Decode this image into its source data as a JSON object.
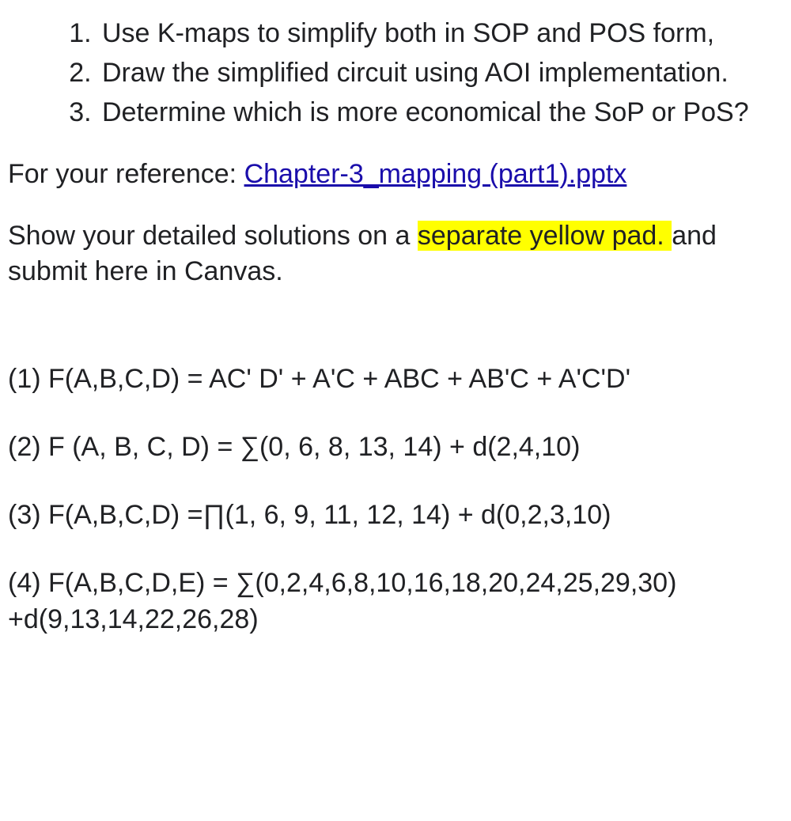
{
  "instructions": {
    "items": [
      "Use K-maps to simplify both in SOP and POS form,",
      "Draw the simplified circuit using AOI implementation.",
      "Determine which is more economical the SoP or PoS?"
    ]
  },
  "reference": {
    "prefix": "For your reference: ",
    "link_text": "Chapter-3_mapping (part1).pptx"
  },
  "submission": {
    "before": "Show your detailed solutions on a ",
    "highlighted": "separate yellow pad. ",
    "after": "and submit here in Canvas."
  },
  "problems": [
    "(1) F(A,B,C,D) = AC' D' + A'C + ABC + AB'C + A'C'D'",
    "(2) F (A, B, C, D) = ∑(0, 6, 8, 13, 14) + d(2,4,10)",
    "(3) F(A,B,C,D) =∏(1, 6, 9, 11, 12, 14) + d(0,2,3,10)",
    "(4) F(A,B,C,D,E) = ∑(0,2,4,6,8,10,16,18,20,24,25,29,30) +d(9,13,14,22,26,28)"
  ]
}
